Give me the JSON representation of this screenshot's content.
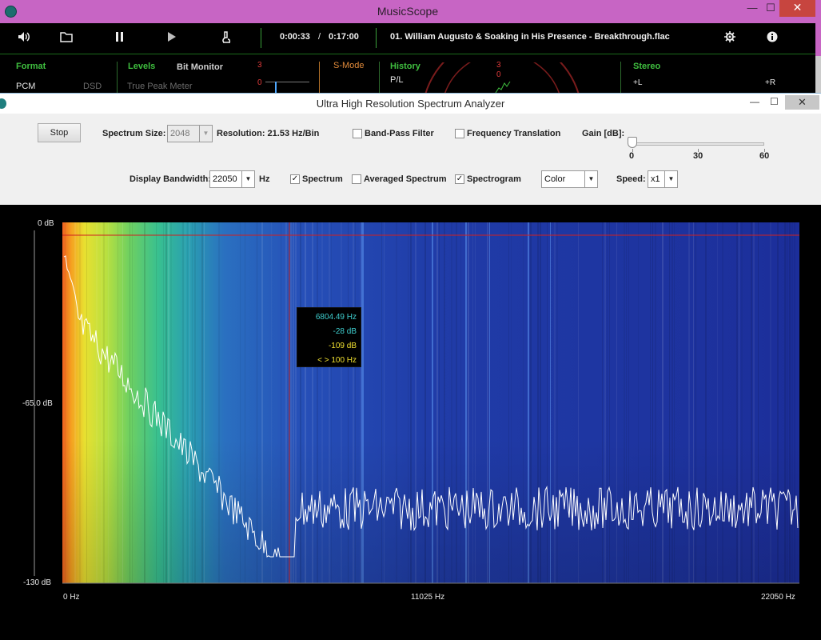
{
  "musicscope": {
    "title": "MusicScope",
    "window_controls": {
      "minimize": "—",
      "maximize": "☐",
      "close": "✕"
    },
    "toolbar": {
      "time_elapsed": "0:00:33",
      "time_sep": "/",
      "time_total": "0:17:00",
      "track": "01. William Augusto & Soaking in His Presence - Breakthrough.flac"
    },
    "panels": {
      "format": {
        "title": "Format",
        "value": "PCM",
        "alt": "DSD"
      },
      "levels": {
        "title": "Levels",
        "sub": "True Peak Meter"
      },
      "bit_monitor": {
        "title": "Bit Monitor",
        "scale_top": "3",
        "scale_zero": "0"
      },
      "smode": {
        "title": "S-Mode"
      },
      "history": {
        "title": "History",
        "value": "P/L",
        "scale_top": "3",
        "scale_zero": "0"
      },
      "stereo": {
        "title": "Stereo",
        "left": "+L",
        "right": "+R"
      }
    }
  },
  "analyzer": {
    "title": "Ultra High Resolution Spectrum Analyzer",
    "window_controls": {
      "minimize": "—",
      "maximize": "☐",
      "close": "✕"
    },
    "controls": {
      "stop_label": "Stop",
      "spectrum_size_label": "Spectrum Size:",
      "spectrum_size_value": "2048",
      "resolution_label": "Resolution: 21.53 Hz/Bin",
      "bandpass_label": "Band-Pass Filter",
      "bandpass_checked": false,
      "freq_translation_label": "Frequency Translation",
      "freq_translation_checked": false,
      "gain_label": "Gain [dB]:",
      "gain_value": 0,
      "gain_ticks": [
        "0",
        "30",
        "60"
      ],
      "display_bandwidth_label": "Display Bandwidth:",
      "display_bandwidth_value": "22050",
      "hz_label": "Hz",
      "spectrum_label": "Spectrum",
      "spectrum_checked": true,
      "averaged_label": "Averaged Spectrum",
      "averaged_checked": false,
      "spectrogram_label": "Spectrogram",
      "spectrogram_checked": true,
      "color_value": "Color",
      "speed_label": "Speed:",
      "speed_value": "x1"
    },
    "plot": {
      "y_labels": [
        "0 dB",
        "-65.0 dB",
        "-130 dB"
      ],
      "x_labels": [
        "0 Hz",
        "11025 Hz",
        "22050 Hz"
      ],
      "tooltip": {
        "freq": "6804.49 Hz",
        "level": "-28 dB",
        "level2": "-109 dB",
        "band": "< > 100 Hz"
      },
      "colors": {
        "spectrum_line": "#ffffff",
        "cursor": "#e02020",
        "tooltip_freq": "#3fd0d0",
        "tooltip_level": "#3fd0d0",
        "tooltip_level2": "#f0e030",
        "tooltip_band": "#f0e030"
      }
    }
  }
}
